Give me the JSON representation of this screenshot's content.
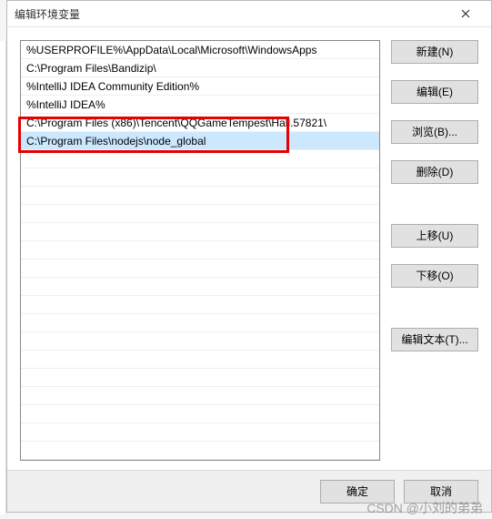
{
  "window": {
    "title": "编辑环境变量"
  },
  "list": {
    "items": [
      "%USERPROFILE%\\AppData\\Local\\Microsoft\\WindowsApps",
      "C:\\Program Files\\Bandizip\\",
      "%IntelliJ IDEA Community Edition%",
      "%IntelliJ IDEA%",
      "C:\\Program Files (x86)\\Tencent\\QQGameTempest\\Hall.57821\\",
      "C:\\Program Files\\nodejs\\node_global"
    ],
    "selected_index": 5,
    "highlighted_index": 5
  },
  "buttons": {
    "new": "新建(N)",
    "edit": "编辑(E)",
    "browse": "浏览(B)...",
    "delete": "删除(D)",
    "move_up": "上移(U)",
    "move_down": "下移(O)",
    "edit_text": "编辑文本(T)...",
    "ok": "确定",
    "cancel": "取消"
  },
  "watermark": "CSDN @小刘的弟弟"
}
